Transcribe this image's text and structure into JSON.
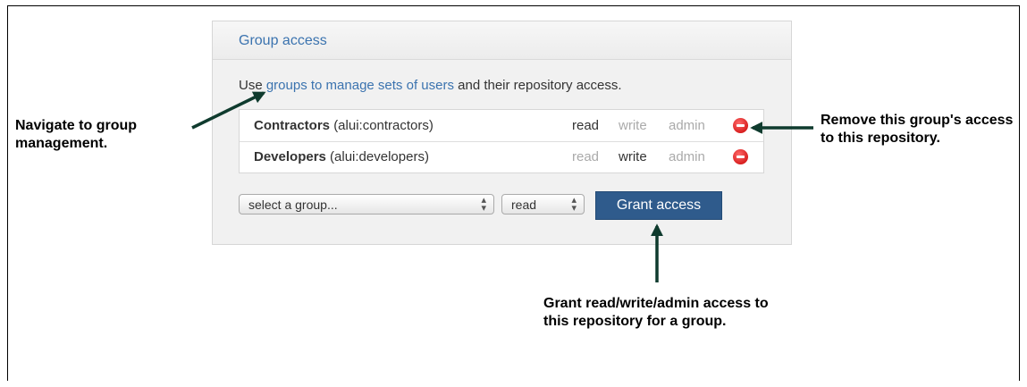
{
  "panel": {
    "title": "Group access",
    "intro_prefix": "Use ",
    "intro_link": "groups to manage sets of users",
    "intro_suffix": " and their repository access."
  },
  "groups": [
    {
      "name": "Contractors",
      "slug": "(alui:contractors)",
      "read": "read",
      "write": "write",
      "admin": "admin",
      "active": "read"
    },
    {
      "name": "Developers",
      "slug": "(alui:developers)",
      "read": "read",
      "write": "write",
      "admin": "admin",
      "active": "write"
    }
  ],
  "form": {
    "group_select": "select a group...",
    "permission_select": "read",
    "grant_label": "Grant access"
  },
  "callouts": {
    "left": "Navigate to group management.",
    "right": "Remove this group's access to this repository.",
    "bottom": "Grant read/write/admin access to this repository for a group."
  },
  "colors": {
    "link": "#3b73af",
    "button": "#2f5b8c",
    "arrow": "#0f3b2e"
  }
}
